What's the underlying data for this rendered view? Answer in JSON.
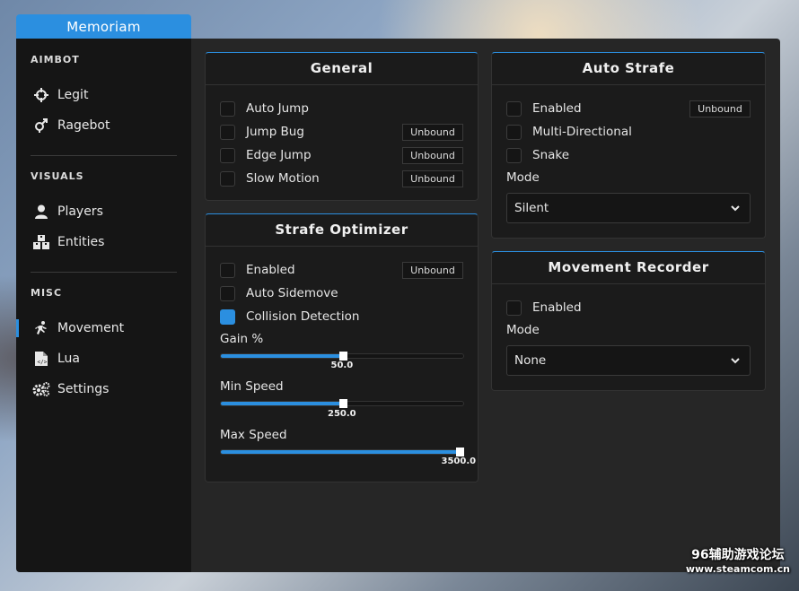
{
  "window": {
    "title": "Memoriam"
  },
  "sidebar": {
    "sections": [
      {
        "header": "AIMBOT",
        "items": [
          {
            "label": "Legit",
            "icon": "crosshair-icon"
          },
          {
            "label": "Ragebot",
            "icon": "gender-icon"
          }
        ]
      },
      {
        "header": "VISUALS",
        "items": [
          {
            "label": "Players",
            "icon": "user-icon"
          },
          {
            "label": "Entities",
            "icon": "boxes-icon"
          }
        ]
      },
      {
        "header": "MISC",
        "items": [
          {
            "label": "Movement",
            "icon": "running-icon"
          },
          {
            "label": "Lua",
            "icon": "file-code-icon"
          },
          {
            "label": "Settings",
            "icon": "gears-icon"
          }
        ]
      }
    ],
    "active": "Movement"
  },
  "general": {
    "title": "General",
    "options": [
      {
        "label": "Auto Jump",
        "checked": false,
        "bind": ""
      },
      {
        "label": "Jump Bug",
        "checked": false,
        "bind": "Unbound"
      },
      {
        "label": "Edge Jump",
        "checked": false,
        "bind": "Unbound"
      },
      {
        "label": "Slow Motion",
        "checked": false,
        "bind": "Unbound"
      }
    ]
  },
  "strafe_optimizer": {
    "title": "Strafe Optimizer",
    "options": [
      {
        "label": "Enabled",
        "checked": false,
        "bind": "Unbound"
      },
      {
        "label": "Auto Sidemove",
        "checked": false,
        "bind": ""
      },
      {
        "label": "Collision Detection",
        "checked": true,
        "bind": ""
      }
    ],
    "sliders": [
      {
        "label": "Gain %",
        "value": "50.0",
        "fraction": 0.5
      },
      {
        "label": "Min Speed",
        "value": "250.0",
        "fraction": 0.5
      },
      {
        "label": "Max Speed",
        "value": "3500.0",
        "fraction": 1.0
      }
    ]
  },
  "auto_strafe": {
    "title": "Auto Strafe",
    "options": [
      {
        "label": "Enabled",
        "checked": false,
        "bind": "Unbound"
      },
      {
        "label": "Multi-Directional",
        "checked": false,
        "bind": ""
      },
      {
        "label": "Snake",
        "checked": false,
        "bind": ""
      }
    ],
    "mode_label": "Mode",
    "mode_value": "Silent"
  },
  "movement_recorder": {
    "title": "Movement Recorder",
    "options": [
      {
        "label": "Enabled",
        "checked": false,
        "bind": ""
      }
    ],
    "mode_label": "Mode",
    "mode_value": "None"
  },
  "watermark": {
    "line1": "96辅助游戏论坛",
    "line2": "www.steamcom.cn"
  },
  "colors": {
    "accent": "#2b8fe0",
    "panel": "#1b1b1b",
    "sidebar": "#151515",
    "main": "#262626"
  }
}
